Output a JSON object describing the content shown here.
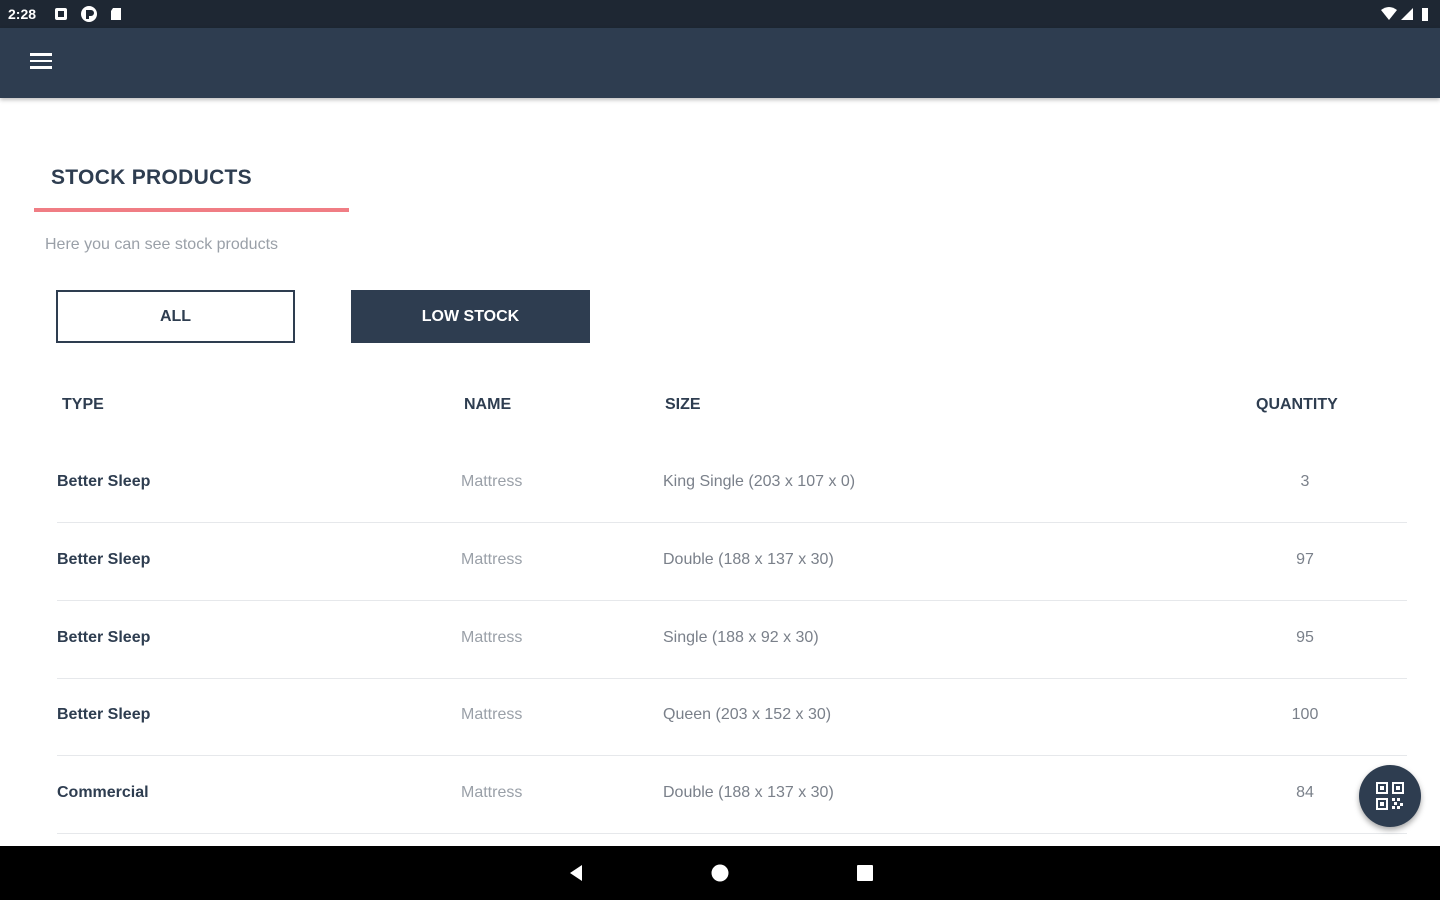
{
  "statusbar": {
    "time": "2:28"
  },
  "page": {
    "title": "STOCK PRODUCTS",
    "subtitle": "Here you can see stock products"
  },
  "filters": {
    "all_label": "ALL",
    "low_stock_label": "LOW STOCK",
    "selected": "LOW STOCK"
  },
  "table": {
    "headers": {
      "type": "TYPE",
      "name": "NAME",
      "size": "SIZE",
      "quantity": "QUANTITY"
    },
    "rows": [
      {
        "type": "Better Sleep",
        "name": "Mattress",
        "size": "King Single (203 x 107 x 0)",
        "quantity": "3"
      },
      {
        "type": "Better Sleep",
        "name": "Mattress",
        "size": "Double (188 x 137 x 30)",
        "quantity": "97"
      },
      {
        "type": "Better Sleep",
        "name": "Mattress",
        "size": "Single (188 x 92 x 30)",
        "quantity": "95"
      },
      {
        "type": "Better Sleep",
        "name": "Mattress",
        "size": "Queen (203 x 152 x 30)",
        "quantity": "100"
      },
      {
        "type": "Commercial",
        "name": "Mattress",
        "size": "Double (188 x 137 x 30)",
        "quantity": "84"
      }
    ]
  },
  "icons": {
    "menu": "hamburger-menu-icon",
    "fab": "qr-code-icon",
    "nav_back": "back-triangle-icon",
    "nav_home": "home-circle-icon",
    "nav_recents": "recents-square-icon"
  },
  "colors": {
    "primary": "#2e3d50",
    "accent": "#f07d84",
    "muted_text": "#9aa0a8"
  }
}
